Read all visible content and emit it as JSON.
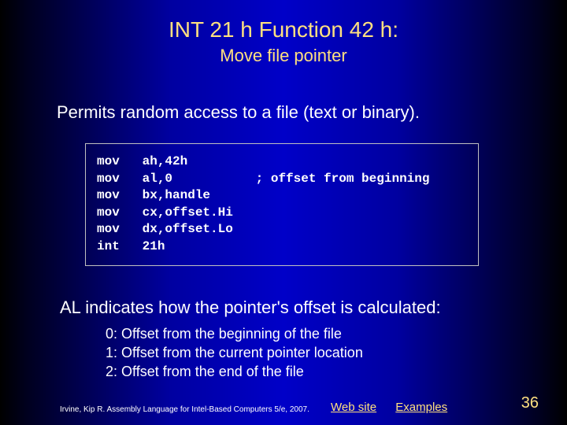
{
  "title": "INT 21 h Function 42 h:",
  "subtitle": "Move file pointer",
  "intro": "Permits random access to a file (text or binary).",
  "code": "mov   ah,42h\nmov   al,0           ; offset from beginning\nmov   bx,handle\nmov   cx,offset.Hi\nmov   dx,offset.Lo\nint   21h",
  "al_line": "AL indicates how the pointer's offset is calculated:",
  "offsets": {
    "o0": "0:  Offset from the beginning of the file",
    "o1": "1:  Offset from the current pointer location",
    "o2": "2:  Offset from the end of the file"
  },
  "footer": {
    "citation": "Irvine, Kip R. Assembly Language for Intel-Based Computers 5/e, 2007.",
    "link1": "Web site",
    "link2": "Examples",
    "page": "36"
  }
}
